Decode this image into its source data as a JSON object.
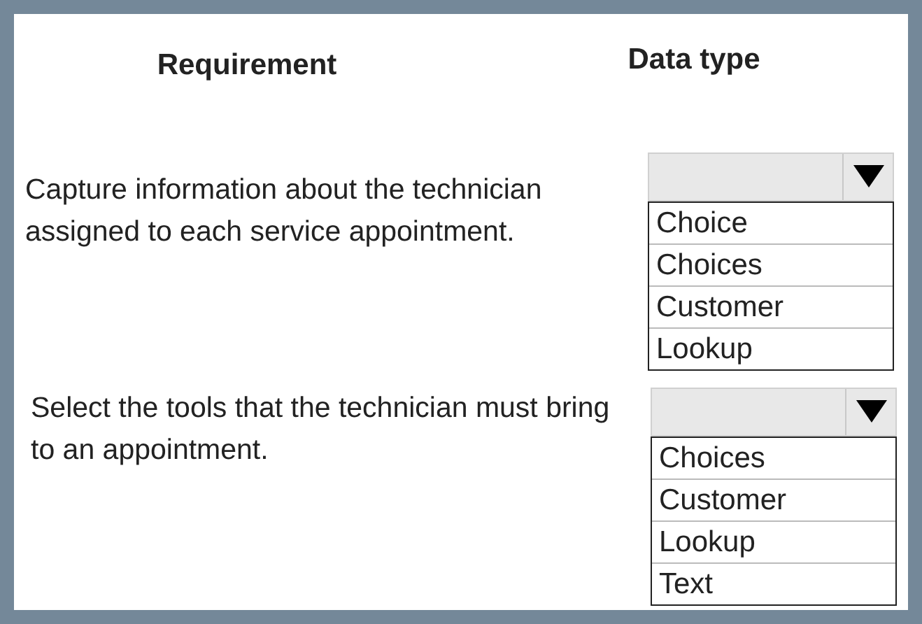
{
  "headers": {
    "requirement": "Requirement",
    "data_type": "Data type"
  },
  "questions": [
    {
      "text": "Capture information about the technician assigned to each service appointment.",
      "options": [
        "Choice",
        "Choices",
        "Customer",
        "Lookup"
      ]
    },
    {
      "text": "Select the tools that the technician must bring to an appointment.",
      "options": [
        "Choices",
        "Customer",
        "Lookup",
        "Text"
      ]
    }
  ]
}
